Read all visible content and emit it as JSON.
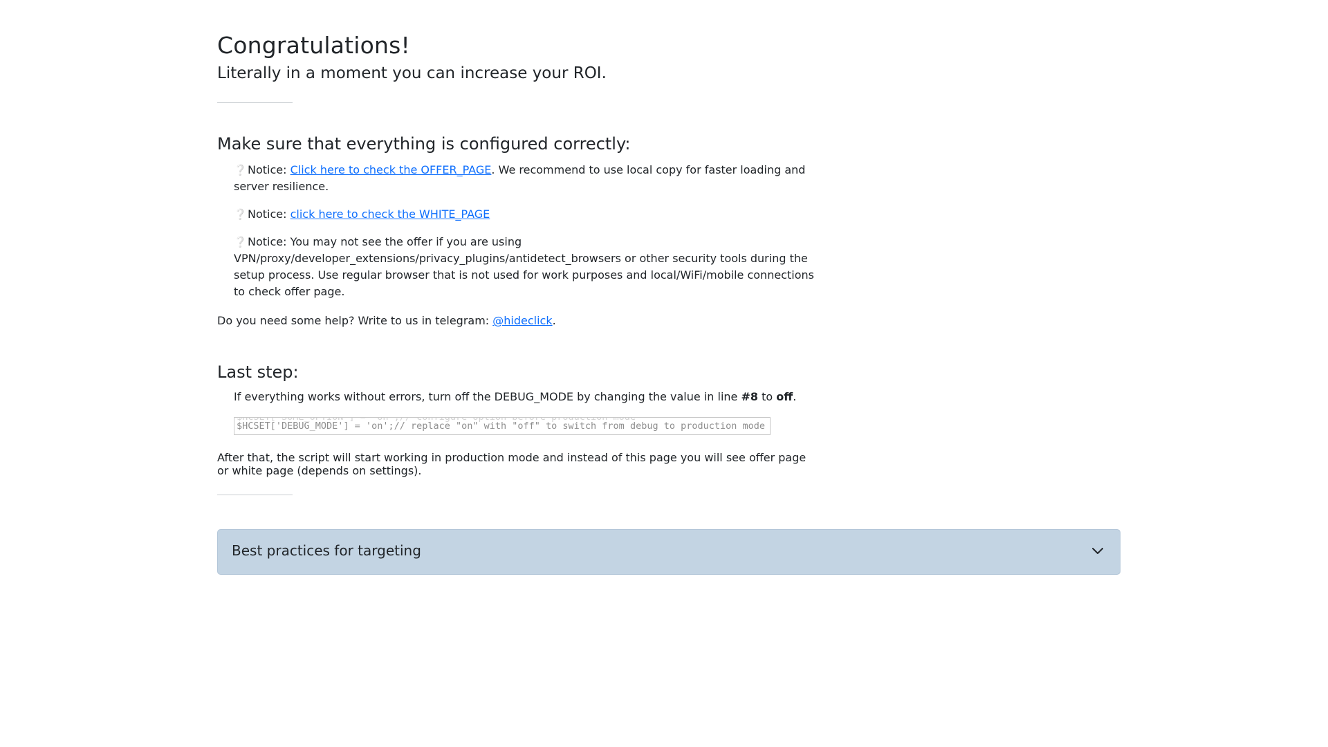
{
  "header": {
    "title": "Congratulations!",
    "subtitle": "Literally in a moment you can increase your ROI."
  },
  "config": {
    "heading": "Make sure that everything is configured correctly:",
    "notices": [
      {
        "label": "Notice:",
        "link_text": "Click here to check the OFFER_PAGE",
        "after": ". We recommend to use local copy for faster loading and server resilience."
      },
      {
        "label": "Notice:",
        "link_text": "click here to check the WHITE_PAGE"
      },
      {
        "label": "Notice:",
        "text": "You may not see the offer if you are using VPN/proxy/developer_extensions/privacy_plugins/antidetect_browsers or other security tools during the setup process. Use regular browser that is not used for work purposes and local/WiFi/mobile connections to check offer page."
      }
    ],
    "help_text": "Do you need some help? Write to us in telegram:",
    "help_link": "@hideclick",
    "help_after": "."
  },
  "last_step": {
    "heading": "Last step:",
    "text_before": "If everything works without errors, turn off the DEBUG_MODE by changing the value in line",
    "line_number": "#8",
    "text_middle": "to",
    "value": "off",
    "text_after": ".",
    "code_ghost": "$HCSET['SOME_OPTION'] = 'on';// configure option before production mode",
    "code_line": "$HCSET['DEBUG_MODE'] = 'on';// replace \"on\" with \"off\" to switch from debug to production mode",
    "after_text": "After that, the script will start working in production mode and instead of this page you will see offer page or white page (depends on settings)."
  },
  "accordion": {
    "title": "Best practices for targeting",
    "icon": "chevron-down-icon"
  }
}
